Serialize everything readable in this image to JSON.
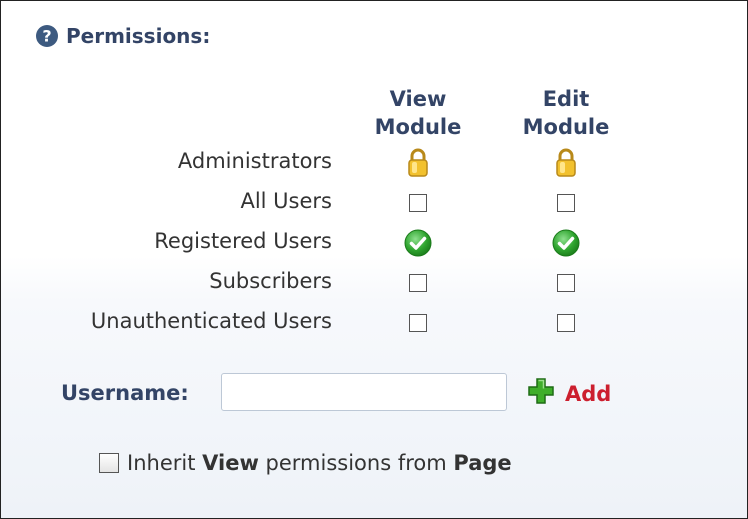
{
  "section": {
    "title": "Permissions:",
    "help_icon": "question-circle-icon"
  },
  "columns": [
    {
      "line1": "View",
      "line2": "Module"
    },
    {
      "line1": "Edit",
      "line2": "Module"
    }
  ],
  "roles": [
    {
      "label": "Administrators",
      "view": "locked",
      "edit": "locked"
    },
    {
      "label": "All Users",
      "view": "unchecked",
      "edit": "unchecked"
    },
    {
      "label": "Registered Users",
      "view": "granted",
      "edit": "granted"
    },
    {
      "label": "Subscribers",
      "view": "unchecked",
      "edit": "unchecked"
    },
    {
      "label": "Unauthenticated Users",
      "view": "unchecked",
      "edit": "unchecked"
    }
  ],
  "username": {
    "label": "Username:",
    "value": "",
    "placeholder": ""
  },
  "add": {
    "label": "Add",
    "icon": "green-plus-icon"
  },
  "inherit": {
    "checked": false,
    "prefix": "Inherit ",
    "bold1": "View",
    "middle": " permissions from ",
    "bold2": "Page"
  },
  "colors": {
    "heading": "#334466",
    "add_link": "#cc1f2e",
    "granted": "#2fa52f",
    "lock": "#f2c12e"
  }
}
